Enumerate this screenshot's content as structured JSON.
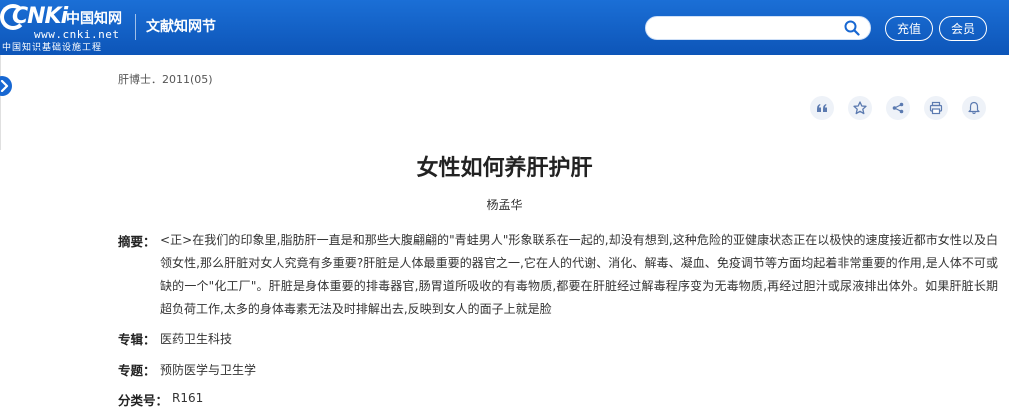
{
  "header": {
    "logo_brand": "CNKi",
    "logo_brand_cn": "中国知网",
    "logo_domain": "www.cnki.net",
    "logo_sub": "中国知识基础设施工程",
    "section_title": "文献知网节",
    "search_placeholder": "",
    "recharge_label": "充值",
    "member_label": "会员",
    "accent_color": "#1767d2"
  },
  "article": {
    "journal_line": "肝博士．2011(05)",
    "title": "女性如何养肝护肝",
    "author": "杨孟华",
    "abstract_label": "摘要：",
    "abstract_text": "<正>在我们的印象里,脂肪肝一直是和那些大腹翩翩的\"青蛙男人\"形象联系在一起的,却没有想到,这种危险的亚健康状态正在以极快的速度接近都市女性以及白领女性,那么肝脏对女人究竟有多重要?肝脏是人体最重要的器官之一,它在人的代谢、消化、解毒、凝血、免疫调节等方面均起着非常重要的作用,是人体不可或缺的一个\"化工厂\"。肝脏是身体重要的排毒器官,肠胃道所吸收的有毒物质,都要在肝脏经过解毒程序变为无毒物质,再经过胆汁或尿液排出体外。如果肝脏长期超负荷工作,太多的身体毒素无法及时排解出去,反映到女人的面子上就是脸",
    "zhuanji_label": "专辑：",
    "zhuanji_value": "医药卫生科技",
    "zhuanti_label": "专题：",
    "zhuanti_value": "预防医学与卫生学",
    "fenlei_label": "分类号：",
    "fenlei_value": "R161"
  },
  "actions": {
    "icons": [
      "quote-icon",
      "star-icon",
      "share-icon",
      "print-icon",
      "bell-icon"
    ]
  }
}
